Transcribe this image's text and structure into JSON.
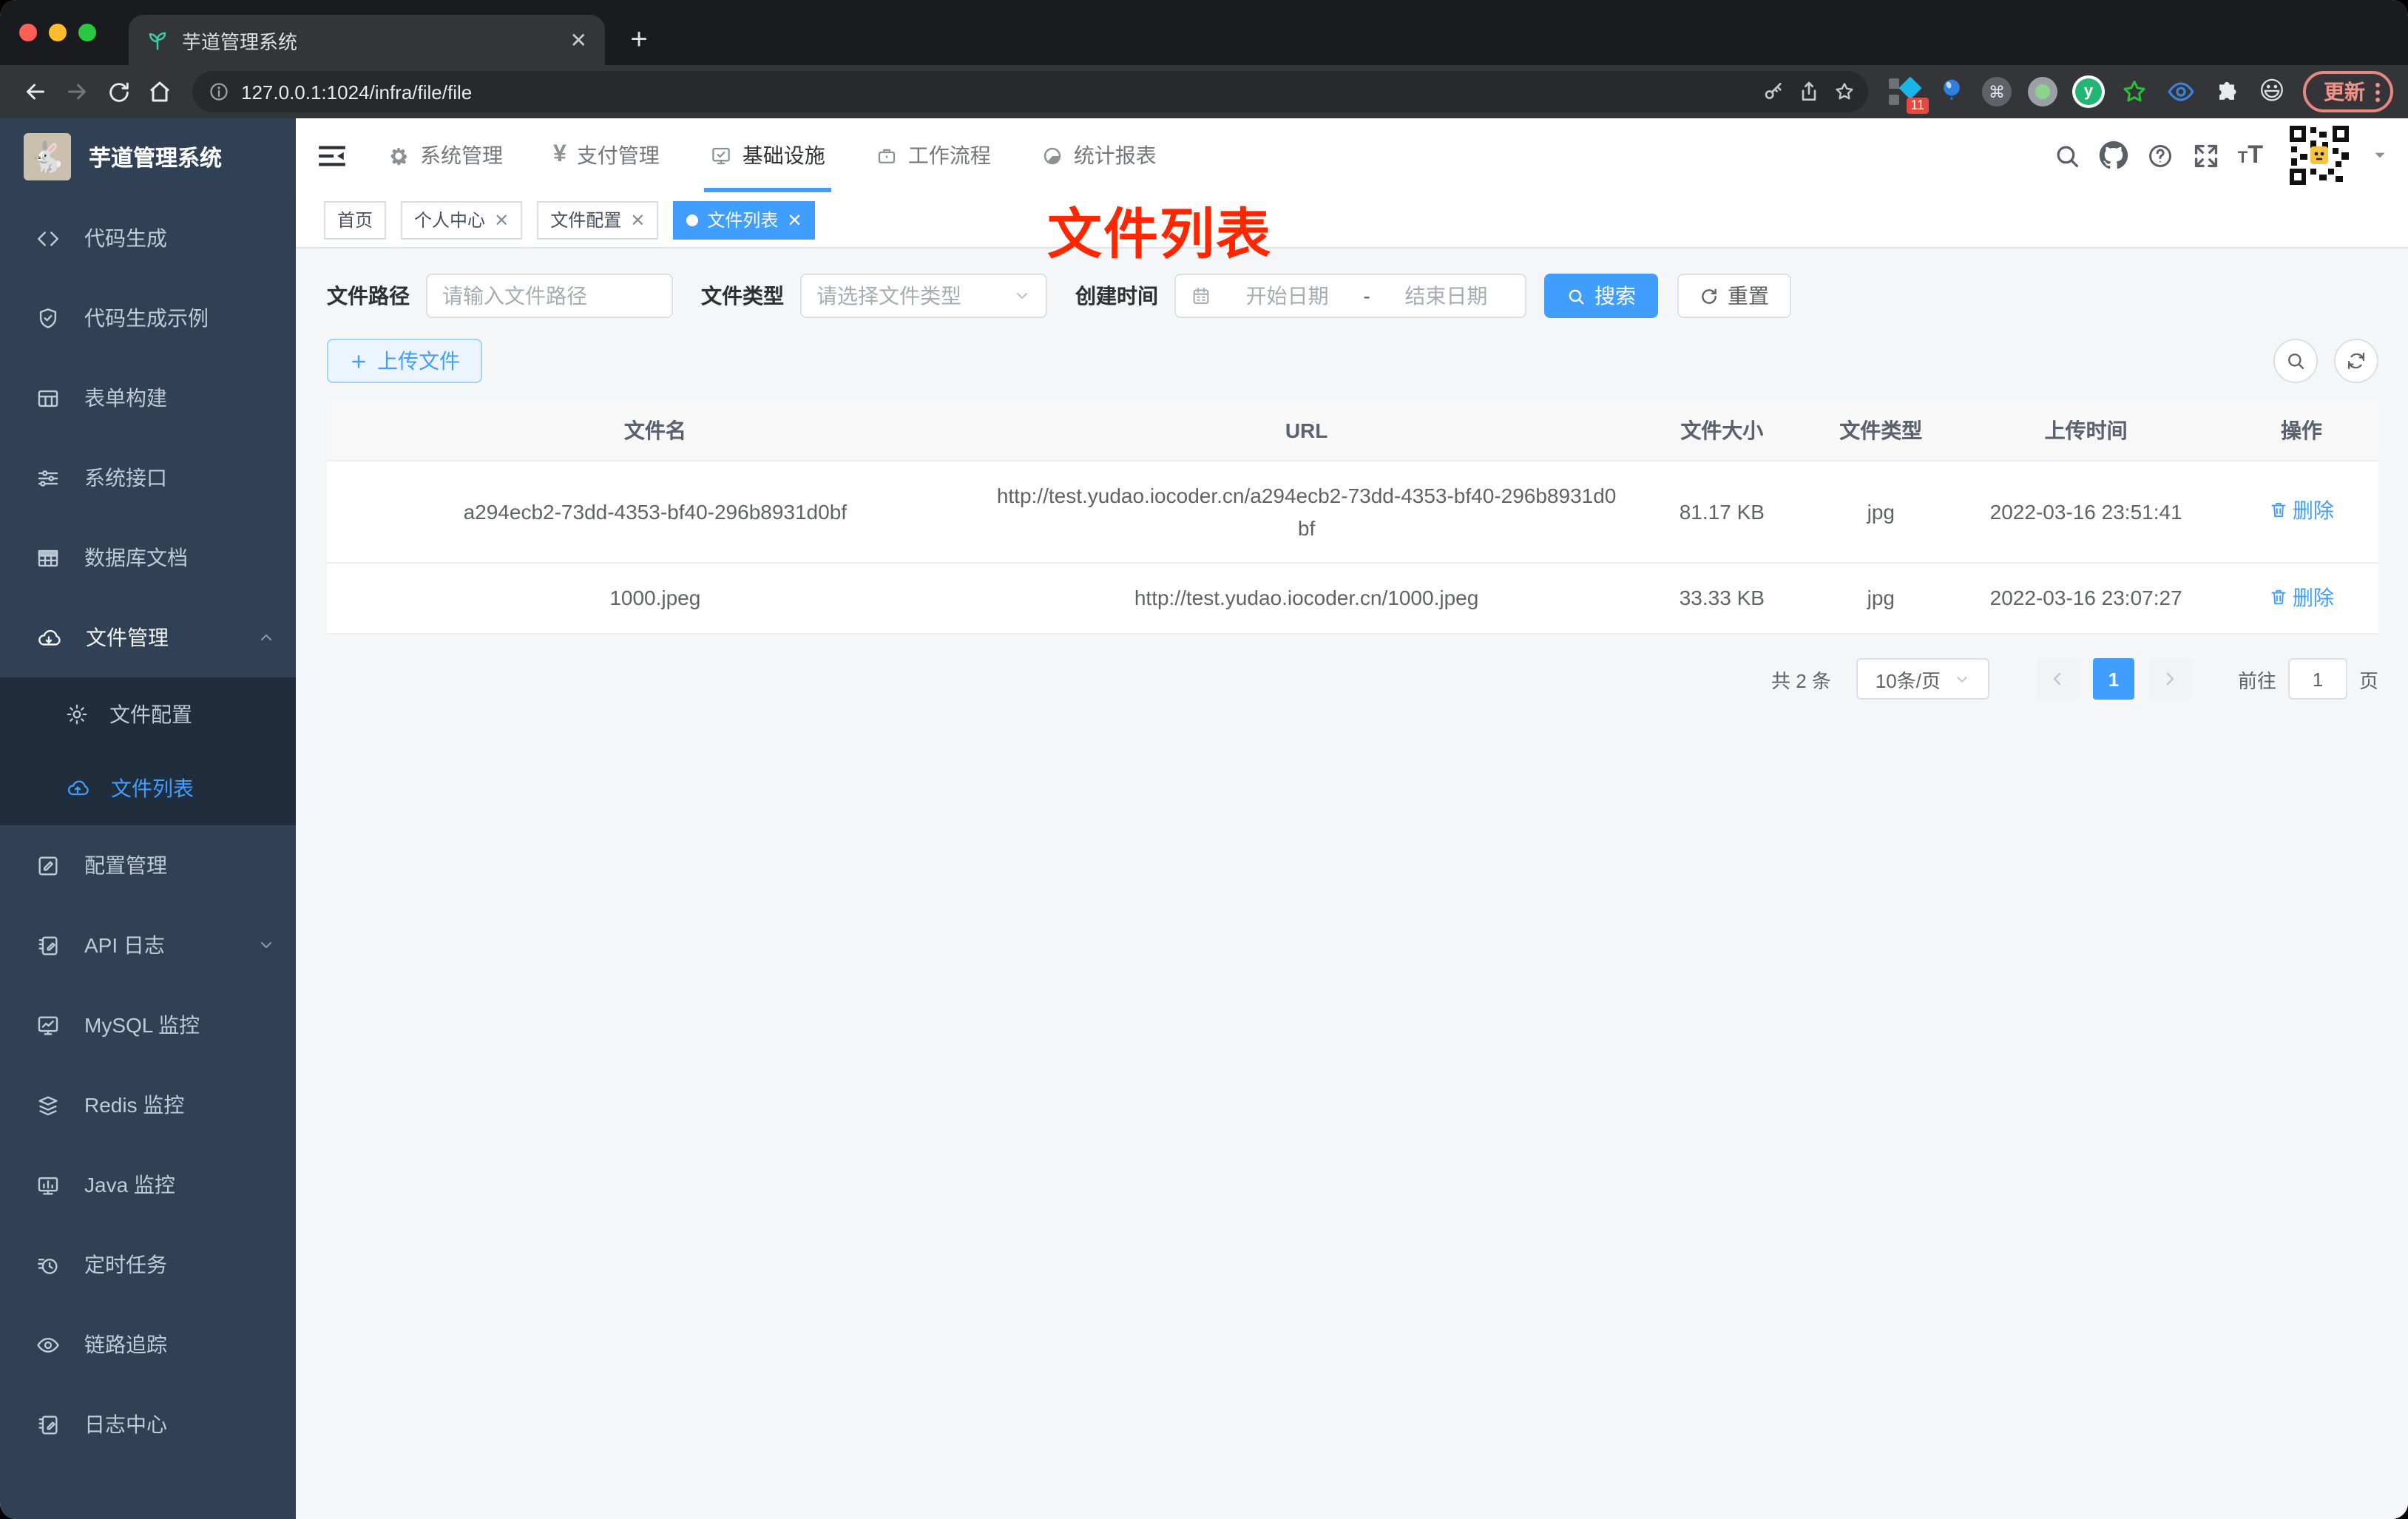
{
  "colors": {
    "accent": "#409eff",
    "sidebar_bg": "#304156",
    "submenu_bg": "#1f2d3d",
    "annotation_red": "#ff2600",
    "active_underline": "#409eff"
  },
  "browser": {
    "tab_title": "芋道管理系统",
    "url": "127.0.0.1:1024/infra/file/file",
    "ext_badge": "11",
    "update_label": "更新"
  },
  "sidebar": {
    "title": "芋道管理系统",
    "items": [
      {
        "label": "代码生成"
      },
      {
        "label": "代码生成示例"
      },
      {
        "label": "表单构建"
      },
      {
        "label": "系统接口"
      },
      {
        "label": "数据库文档"
      },
      {
        "label": "文件管理",
        "children": [
          {
            "label": "文件配置"
          },
          {
            "label": "文件列表"
          }
        ]
      },
      {
        "label": "配置管理"
      },
      {
        "label": "API 日志"
      },
      {
        "label": "MySQL 监控"
      },
      {
        "label": "Redis 监控"
      },
      {
        "label": "Java 监控"
      },
      {
        "label": "定时任务"
      },
      {
        "label": "链路追踪"
      },
      {
        "label": "日志中心"
      }
    ]
  },
  "topnav": {
    "items": [
      {
        "label": "系统管理"
      },
      {
        "label": "支付管理"
      },
      {
        "label": "基础设施"
      },
      {
        "label": "工作流程"
      },
      {
        "label": "统计报表"
      }
    ]
  },
  "tabs": {
    "items": [
      {
        "label": "首页"
      },
      {
        "label": "个人中心"
      },
      {
        "label": "文件配置"
      },
      {
        "label": "文件列表"
      }
    ]
  },
  "annotation": {
    "text": "文件列表"
  },
  "filters": {
    "path_label": "文件路径",
    "path_placeholder": "请输入文件路径",
    "type_label": "文件类型",
    "type_placeholder": "请选择文件类型",
    "date_label": "创建时间",
    "date_start": "开始日期",
    "date_separator": "-",
    "date_end": "结束日期",
    "search_label": "搜索",
    "reset_label": "重置"
  },
  "toolbar": {
    "upload_label": "上传文件"
  },
  "table": {
    "headers": [
      "文件名",
      "URL",
      "文件大小",
      "文件类型",
      "上传时间",
      "操作"
    ],
    "rows": [
      {
        "name": "a294ecb2-73dd-4353-bf40-296b8931d0bf",
        "url": "http://test.yudao.iocoder.cn/a294ecb2-73dd-4353-bf40-296b8931d0bf",
        "size": "81.17 KB",
        "type": "jpg",
        "time": "2022-03-16 23:51:41",
        "action": "删除"
      },
      {
        "name": "1000.jpeg",
        "url": "http://test.yudao.iocoder.cn/1000.jpeg",
        "size": "33.33 KB",
        "type": "jpg",
        "time": "2022-03-16 23:07:27",
        "action": "删除"
      }
    ]
  },
  "pagination": {
    "total": "共 2 条",
    "page_size": "10条/页",
    "current_page": "1",
    "goto_label": "前往",
    "goto_value": "1",
    "unit_label": "页"
  }
}
